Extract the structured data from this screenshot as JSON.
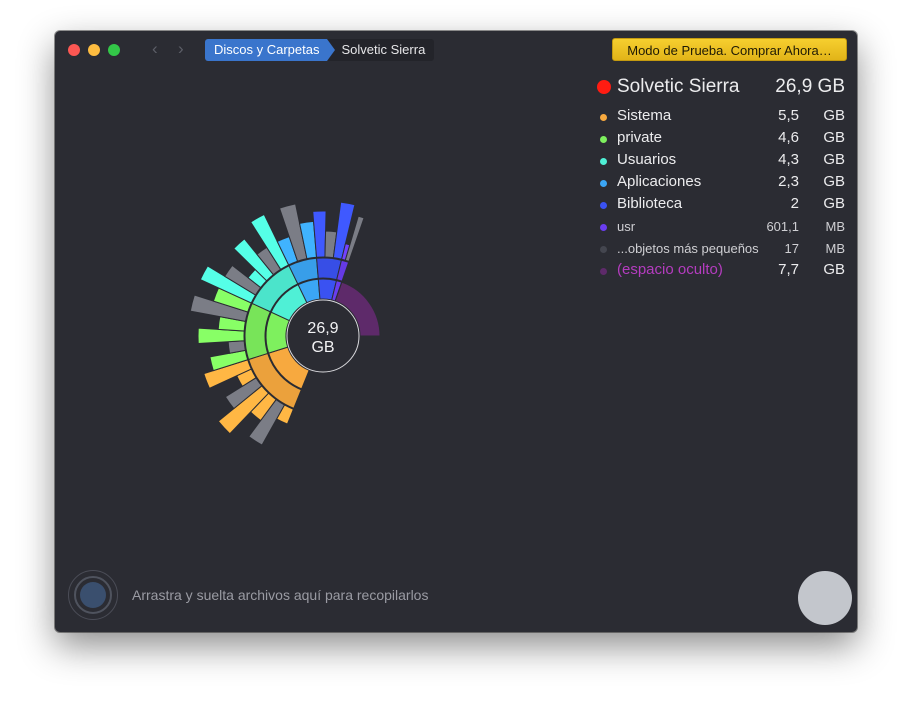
{
  "toolbar": {
    "back_icon": "chevron-left-icon",
    "forward_icon": "chevron-right-icon",
    "breadcrumbs": [
      "Discos y Carpetas",
      "Solvetic Sierra"
    ],
    "buy_label": "Modo de Prueba. Comprar Ahora…"
  },
  "colors": {
    "close": "#fc5753",
    "minimize": "#fdbc40",
    "maximize": "#33c748",
    "breadcrumb_active": "#3a75cc",
    "buy_button": "#f1c627",
    "root_dot": "#ff1c12"
  },
  "legend": {
    "title": "Solvetic Sierra",
    "total": "26,9 GB",
    "items": [
      {
        "label": "Sistema",
        "num": "5,5",
        "unit": "GB",
        "color": "#f7a93f"
      },
      {
        "label": "private",
        "num": "4,6",
        "unit": "GB",
        "color": "#7ef05e"
      },
      {
        "label": "Usuarios",
        "num": "4,3",
        "unit": "GB",
        "color": "#4ff0d6"
      },
      {
        "label": "Aplicaciones",
        "num": "2,3",
        "unit": "GB",
        "color": "#3ba6f5"
      },
      {
        "label": "Biblioteca",
        "num": "2",
        "unit": "GB",
        "color": "#3a52f2"
      },
      {
        "label": "usr",
        "num": "601,1",
        "unit": "MB",
        "color": "#6a3df0"
      },
      {
        "label": "...objetos más pequeños",
        "num": "17",
        "unit": "MB",
        "color": "#44464f"
      },
      {
        "label": "(espacio oculto)",
        "num": "7,7",
        "unit": "GB",
        "color": "#5e2a6a"
      }
    ]
  },
  "chart_data": {
    "type": "sunburst",
    "center_value": "26,9",
    "center_unit": "GB",
    "segments": [
      {
        "label": "Sistema",
        "value": 5.5,
        "unit": "GB",
        "color": "#f7a93f"
      },
      {
        "label": "private",
        "value": 4.6,
        "unit": "GB",
        "color": "#7ef05e"
      },
      {
        "label": "Usuarios",
        "value": 4.3,
        "unit": "GB",
        "color": "#4ff0d6"
      },
      {
        "label": "Aplicaciones",
        "value": 2.3,
        "unit": "GB",
        "color": "#3ba6f5"
      },
      {
        "label": "Biblioteca",
        "value": 2,
        "unit": "GB",
        "color": "#3a52f2"
      },
      {
        "label": "usr",
        "value": 0.6011,
        "unit": "GB",
        "color": "#6a3df0"
      },
      {
        "label": "...objetos más pequeños",
        "value": 0.017,
        "unit": "GB",
        "color": "#44464f"
      },
      {
        "label": "(espacio oculto)",
        "value": 7.7,
        "unit": "GB",
        "color": "#5e2a6a"
      }
    ]
  },
  "footer": {
    "drop_text": "Arrastra y suelta archivos aquí para recopilarlos"
  }
}
